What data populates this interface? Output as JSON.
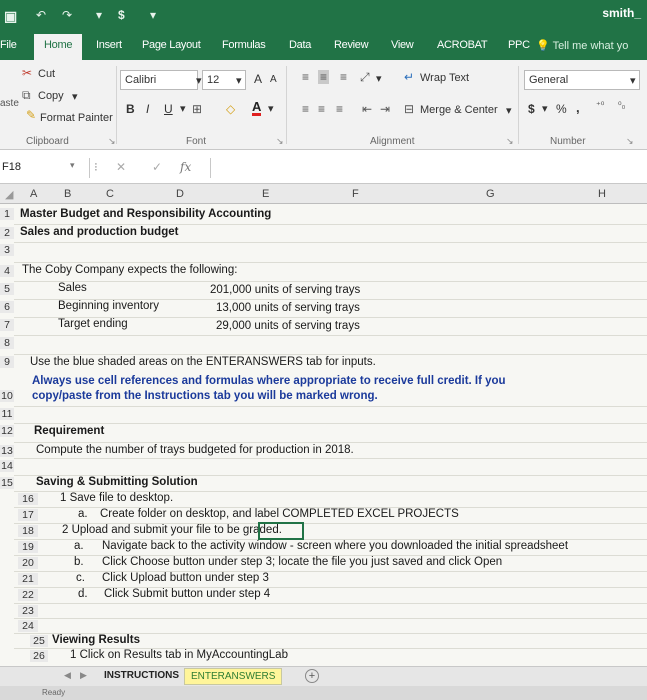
{
  "titlebar": {
    "quick_access": [
      "↶",
      "↷",
      "▾",
      "$",
      "▾"
    ],
    "user": "smith_"
  },
  "menu": {
    "tabs": [
      "File",
      "Home",
      "Insert",
      "Page Layout",
      "Formulas",
      "Data",
      "Review",
      "View",
      "ACROBAT",
      "PPC"
    ],
    "active": "Home",
    "tell_me": "Tell me what yo"
  },
  "ribbon": {
    "clipboard": {
      "paste": "aste",
      "cut": "Cut",
      "copy": "Copy",
      "format_painter": "Format Painter",
      "group": "Clipboard"
    },
    "font": {
      "name": "Calibri",
      "size": "12",
      "grow": "A",
      "shrink": "A",
      "bold": "B",
      "italic": "I",
      "underline": "U",
      "font_color": "A",
      "group": "Font"
    },
    "alignment": {
      "wrap_text": "Wrap Text",
      "merge_center": "Merge & Center",
      "group": "Alignment"
    },
    "number": {
      "format": "General",
      "currency": "$",
      "percent": "%",
      "comma": ",",
      "group": "Number"
    }
  },
  "formula_bar": {
    "name_box": "F18",
    "cancel": "✕",
    "enter": "✓",
    "fx": "fx",
    "value": ""
  },
  "columns": [
    "A",
    "B",
    "C",
    "D",
    "E",
    "F",
    "G",
    "H"
  ],
  "rows": [
    {
      "num": "1",
      "text": "Master Budget and Responsibility Accounting"
    },
    {
      "num": "2",
      "text": "Sales and production budget"
    },
    {
      "num": "3",
      "text": ""
    },
    {
      "num": "4",
      "text": "The Coby Company expects the following:"
    },
    {
      "num": "5",
      "label": "Sales",
      "value": "201,000 units of serving trays"
    },
    {
      "num": "6",
      "label": "Beginning inventory",
      "value": "13,000 units of serving trays"
    },
    {
      "num": "7",
      "label": "Target ending",
      "value": "29,000 units of serving trays"
    },
    {
      "num": "8",
      "text": ""
    },
    {
      "num": "9",
      "text": "Use the blue shaded areas on the ENTERANSWERS tab for inputs."
    },
    {
      "num": "",
      "text": "Always use cell references and formulas where appropriate to receive full credit. If you"
    },
    {
      "num": "10",
      "text": "copy/paste from the Instructions tab you will be marked wrong."
    },
    {
      "num": "11",
      "text": ""
    },
    {
      "num": "12",
      "text": "Requirement"
    },
    {
      "num": "13",
      "text": "Compute the number of trays budgeted for production in 2018."
    },
    {
      "num": "14",
      "text": ""
    },
    {
      "num": "15",
      "text": "Saving & Submitting Solution"
    },
    {
      "num": "16",
      "text": "1 Save file to desktop."
    },
    {
      "num": "17",
      "marker": "a.",
      "text": "Create folder on desktop, and label COMPLETED EXCEL PROJECTS"
    },
    {
      "num": "18",
      "text": "2 Upload and submit your file to be graded."
    },
    {
      "num": "19",
      "marker": "a.",
      "text": "Navigate back to the activity window - screen where you downloaded the initial spreadsheet"
    },
    {
      "num": "20",
      "marker": "b.",
      "text": "Click Choose button under step 3; locate the file you just saved and click Open"
    },
    {
      "num": "21",
      "marker": "c.",
      "text": "Click Upload button under step 3"
    },
    {
      "num": "22",
      "marker": "d.",
      "text": "Click Submit button under step 4"
    },
    {
      "num": "23",
      "text": ""
    },
    {
      "num": "24",
      "text": ""
    },
    {
      "num": "25",
      "text": "Viewing Results"
    },
    {
      "num": "26",
      "text": "1 Click on Results tab in MyAccountingLab"
    }
  ],
  "sheet_tabs": {
    "instructions": "INSTRUCTIONS",
    "enteranswers": "ENTERANSWERS",
    "add": "+"
  },
  "status": {
    "text": "Ready"
  }
}
